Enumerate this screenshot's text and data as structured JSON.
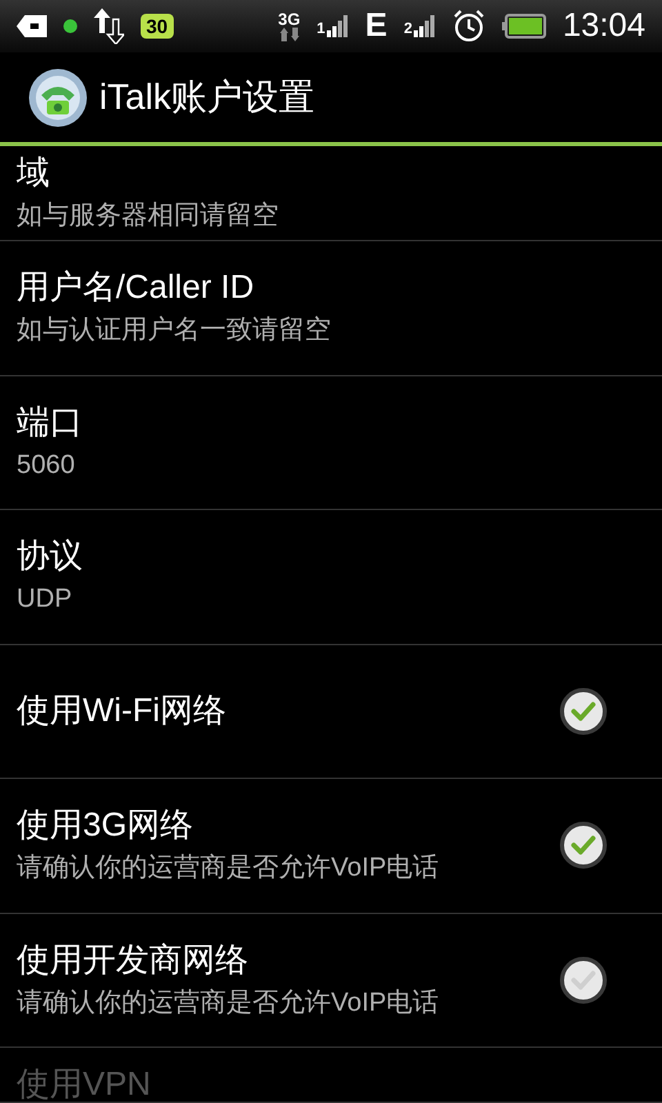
{
  "status_bar": {
    "network": "3G",
    "sim_1": "1",
    "data": "E",
    "sim_2": "2",
    "battery_label": "30",
    "time": "13:04"
  },
  "header": {
    "title": "iTalk账户设置"
  },
  "settings": [
    {
      "kind": "text",
      "title": "域",
      "summary": "如与服务器相同请留空",
      "disabled": false
    },
    {
      "kind": "text",
      "title": "用户名/Caller ID",
      "summary": "如与认证用户名一致请留空",
      "disabled": false
    },
    {
      "kind": "text",
      "title": "端口",
      "summary": "5060",
      "disabled": false
    },
    {
      "kind": "text",
      "title": "协议",
      "summary": "UDP",
      "disabled": false
    },
    {
      "kind": "checkbox",
      "title": "使用Wi-Fi网络",
      "checked": true,
      "disabled": false
    },
    {
      "kind": "checkbox",
      "title": "使用3G网络",
      "summary": "请确认你的运营商是否允许VoIP电话",
      "checked": true,
      "disabled": false
    },
    {
      "kind": "checkbox",
      "title": "使用开发商网络",
      "summary": "请确认你的运营商是否允许VoIP电话",
      "checked": false,
      "disabled": false
    },
    {
      "kind": "checkbox",
      "title": "使用VPN",
      "disabled": true
    }
  ]
}
